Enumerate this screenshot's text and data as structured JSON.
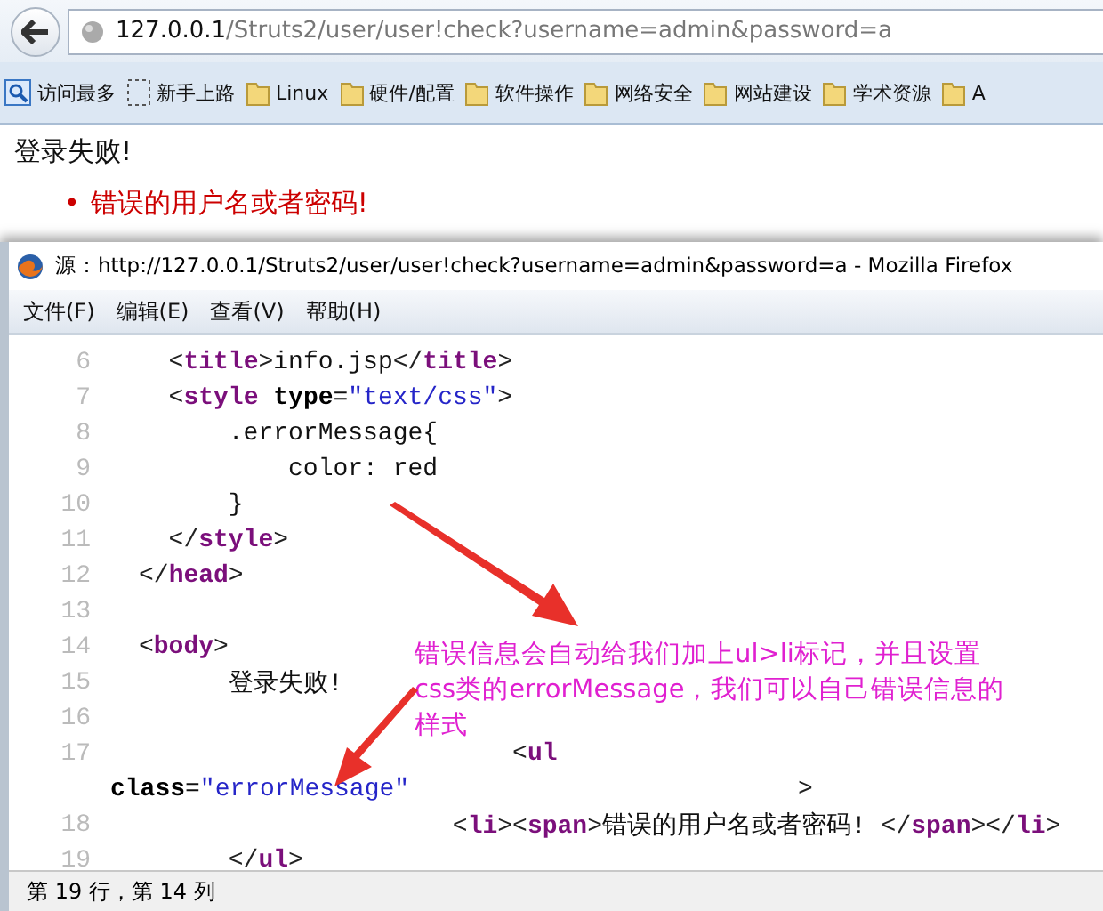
{
  "browser": {
    "url_host": "127.0.0.1",
    "url_path": "/Struts2/user/user!check?username=admin&password=a",
    "bookmarks": [
      {
        "kind": "most",
        "label": "访问最多"
      },
      {
        "kind": "blank",
        "label": "新手上路"
      },
      {
        "kind": "folder",
        "label": "Linux"
      },
      {
        "kind": "folder",
        "label": "硬件/配置"
      },
      {
        "kind": "folder",
        "label": "软件操作"
      },
      {
        "kind": "folder",
        "label": "网络安全"
      },
      {
        "kind": "folder",
        "label": "网站建设"
      },
      {
        "kind": "folder",
        "label": "学术资源"
      },
      {
        "kind": "folder",
        "label": "A"
      }
    ],
    "page": {
      "heading": "登录失败!",
      "errors": [
        {
          "bullet": "•",
          "text": "错误的用户名或者密码!"
        }
      ]
    }
  },
  "source_window": {
    "title": "源：http://127.0.0.1/Struts2/user/user!check?username=admin&password=a - Mozilla Firefox",
    "menu": [
      "文件(F)",
      "编辑(E)",
      "查看(V)",
      "帮助(H)"
    ],
    "lines": [
      {
        "kind": "line",
        "number": "6",
        "tokens": [
          {
            "kind": "punct",
            "t": "  <"
          },
          {
            "kind": "tag",
            "t": "title"
          },
          {
            "kind": "punct",
            "t": ">"
          },
          {
            "kind": "text",
            "t": "info.jsp"
          },
          {
            "kind": "punct",
            "t": "</"
          },
          {
            "kind": "tag",
            "t": "title"
          },
          {
            "kind": "punct",
            "t": ">"
          }
        ]
      },
      {
        "kind": "line",
        "number": "7",
        "tokens": [
          {
            "kind": "punct",
            "t": "  <"
          },
          {
            "kind": "tag",
            "t": "style"
          },
          {
            "kind": "attr",
            "t": " type"
          },
          {
            "kind": "text",
            "t": "="
          },
          {
            "kind": "value",
            "t": "\"text/css\""
          },
          {
            "kind": "punct",
            "t": ">"
          }
        ]
      },
      {
        "kind": "line",
        "number": "8",
        "tokens": [
          {
            "kind": "text",
            "t": "      .errorMessage{"
          }
        ]
      },
      {
        "kind": "line",
        "number": "9",
        "tokens": [
          {
            "kind": "text",
            "t": "          color: red"
          }
        ]
      },
      {
        "kind": "line",
        "number": "10",
        "tokens": [
          {
            "kind": "text",
            "t": "      }"
          }
        ]
      },
      {
        "kind": "line",
        "number": "11",
        "tokens": [
          {
            "kind": "punct",
            "t": "  </"
          },
          {
            "kind": "tag",
            "t": "style"
          },
          {
            "kind": "punct",
            "t": ">"
          }
        ]
      },
      {
        "kind": "line",
        "number": "12",
        "tokens": [
          {
            "kind": "punct",
            "t": "</"
          },
          {
            "kind": "tag",
            "t": "head"
          },
          {
            "kind": "punct",
            "t": ">"
          }
        ]
      },
      {
        "kind": "line",
        "number": "13"
      },
      {
        "kind": "line",
        "number": "14",
        "tokens": [
          {
            "kind": "punct",
            "t": "<"
          },
          {
            "kind": "tag",
            "t": "body"
          },
          {
            "kind": "punct",
            "t": ">"
          }
        ]
      },
      {
        "kind": "line",
        "number": "15",
        "tokens": [
          {
            "kind": "text",
            "t": "      登录失败!"
          }
        ]
      },
      {
        "kind": "line",
        "number": "16"
      },
      {
        "kind": "line",
        "number": "17",
        "tokens": [
          {
            "kind": "punct",
            "t": "                         <"
          },
          {
            "kind": "tag",
            "t": "ul"
          }
        ]
      },
      {
        "kind": "wrap",
        "tokens": [
          {
            "kind": "attr",
            "t": "class"
          },
          {
            "kind": "text",
            "t": "="
          },
          {
            "kind": "value",
            "t": "\"errorMessage\""
          },
          {
            "kind": "punct",
            "t": "                          >"
          }
        ]
      },
      {
        "kind": "line",
        "number": "18",
        "tokens": [
          {
            "kind": "punct",
            "t": "                     <"
          },
          {
            "kind": "tag",
            "t": "li"
          },
          {
            "kind": "punct",
            "t": "><"
          },
          {
            "kind": "tag",
            "t": "span"
          },
          {
            "kind": "punct",
            "t": ">"
          },
          {
            "kind": "text",
            "t": "错误的用户名或者密码! "
          },
          {
            "kind": "punct",
            "t": "</"
          },
          {
            "kind": "tag",
            "t": "span"
          },
          {
            "kind": "punct",
            "t": "></"
          },
          {
            "kind": "tag",
            "t": "li"
          },
          {
            "kind": "punct",
            "t": ">"
          }
        ]
      },
      {
        "kind": "line",
        "number": "19",
        "tokens": [
          {
            "kind": "punct",
            "t": "      </"
          },
          {
            "kind": "tag",
            "t": "ul"
          },
          {
            "kind": "punct",
            "t": ">"
          }
        ]
      }
    ],
    "annotation": "错误信息会自动给我们加上ul>li标记，并且设置css类的errorMessage，我们可以自己错误信息的样式",
    "status": "第 19 行，第 14 列"
  }
}
